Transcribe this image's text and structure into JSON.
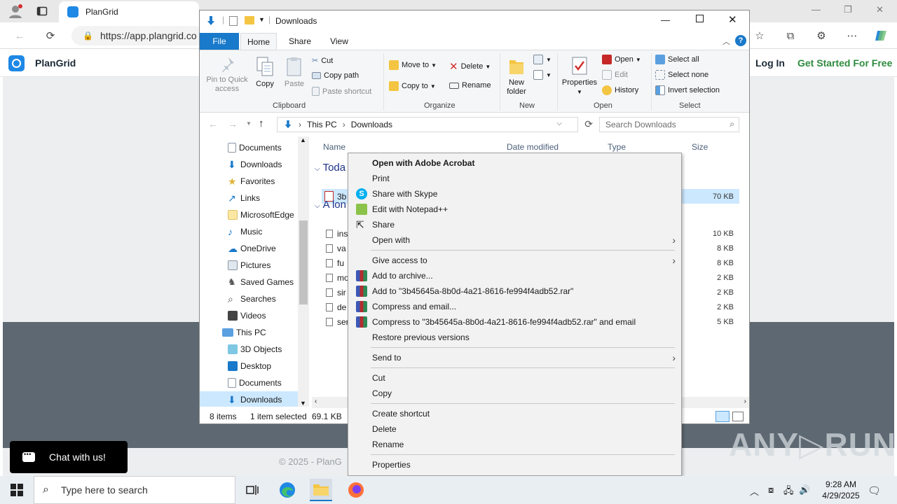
{
  "browser": {
    "tab_title": "PlanGrid",
    "url": "https://app.plangrid.co"
  },
  "page": {
    "brand": "PlanGrid",
    "login": "Log In",
    "get_started": "Get Started For Free",
    "copyright": "© 2025 - PlanG",
    "chat": "Chat with us!",
    "watermark": "ANY▷RUN"
  },
  "explorer": {
    "title": "Downloads",
    "tabs": {
      "file": "File",
      "home": "Home",
      "share": "Share",
      "view": "View"
    },
    "ribbon": {
      "pin": "Pin to Quick access",
      "copy": "Copy",
      "paste": "Paste",
      "cut": "Cut",
      "copy_path": "Copy path",
      "paste_shortcut": "Paste shortcut",
      "clipboard": "Clipboard",
      "move_to": "Move to",
      "copy_to": "Copy to",
      "delete": "Delete",
      "rename": "Rename",
      "organize": "Organize",
      "new_folder": "New folder",
      "new": "New",
      "properties": "Properties",
      "open": "Open",
      "edit": "Edit",
      "history": "History",
      "open_group": "Open",
      "select_all": "Select all",
      "select_none": "Select none",
      "invert_selection": "Invert selection",
      "select": "Select"
    },
    "address": {
      "this_pc": "This PC",
      "current": "Downloads"
    },
    "search_placeholder": "Search Downloads",
    "nav": [
      "Documents",
      "Downloads",
      "Favorites",
      "Links",
      "MicrosoftEdge",
      "Music",
      "OneDrive",
      "Pictures",
      "Saved Games",
      "Searches",
      "Videos",
      "This PC",
      "3D Objects",
      "Desktop",
      "Documents",
      "Downloads"
    ],
    "columns": {
      "name": "Name",
      "date": "Date modified",
      "type": "Type",
      "size": "Size"
    },
    "groups": {
      "today": "Toda",
      "long_ago": "A lon"
    },
    "files_today": [
      {
        "name": "3b",
        "size": "70 KB"
      }
    ],
    "files_old": [
      {
        "name": "ins",
        "size": "10 KB"
      },
      {
        "name": "va",
        "size": "8 KB"
      },
      {
        "name": "fu",
        "size": "8 KB"
      },
      {
        "name": "mo",
        "size": "2 KB"
      },
      {
        "name": "sir",
        "size": "2 KB"
      },
      {
        "name": "de",
        "size": "2 KB"
      },
      {
        "name": "ser",
        "size": "5 KB"
      }
    ],
    "status": {
      "items": "8 items",
      "selected": "1 item selected",
      "size": "69.1 KB"
    }
  },
  "context_menu": {
    "open_acrobat": "Open with Adobe Acrobat",
    "print": "Print",
    "share_skype": "Share with Skype",
    "edit_notepad": "Edit with Notepad++",
    "share": "Share",
    "open_with": "Open with",
    "give_access": "Give access to",
    "add_archive": "Add to archive...",
    "add_to_rar": "Add to \"3b45645a-8b0d-4a21-8616-fe994f4adb52.rar\"",
    "compress_email": "Compress and email...",
    "compress_rar_email": "Compress to \"3b45645a-8b0d-4a21-8616-fe994f4adb52.rar\" and email",
    "restore": "Restore previous versions",
    "send_to": "Send to",
    "cut": "Cut",
    "copy": "Copy",
    "create_shortcut": "Create shortcut",
    "delete": "Delete",
    "rename": "Rename",
    "properties": "Properties"
  },
  "taskbar": {
    "search_placeholder": "Type here to search",
    "time": "9:28 AM",
    "date": "4/29/2025"
  }
}
